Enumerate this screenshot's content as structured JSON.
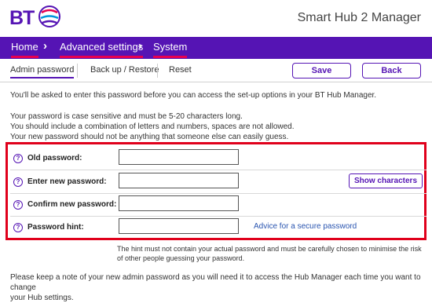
{
  "header": {
    "logo_text": "BT",
    "app_title": "Smart Hub 2 Manager"
  },
  "nav": {
    "items": [
      "Home",
      "Advanced settings",
      "System"
    ]
  },
  "tabs": {
    "items": [
      "Admin password",
      "Back up / Restore",
      "Reset"
    ],
    "active": "Admin password"
  },
  "actions": {
    "save_label": "Save",
    "back_label": "Back"
  },
  "intro": {
    "line1": "You'll be asked to enter this password before you can access the set-up options in your BT Hub Manager.",
    "rules": [
      "Your password is case sensitive and must be 5-20 characters long.",
      "You should include a combination of letters and numbers, spaces are not allowed.",
      "Your new password should not be anything that someone else can easily guess."
    ]
  },
  "form": {
    "old_password_label": "Old password:",
    "old_password_value": "",
    "new_password_label": "Enter new password:",
    "new_password_value": "",
    "confirm_password_label": "Confirm new password:",
    "confirm_password_value": "",
    "hint_label": "Password hint:",
    "hint_value": "",
    "show_characters_label": "Show characters",
    "advice_link_label": "Advice for a secure password",
    "help_glyph": "?"
  },
  "hint_note": {
    "line1": "The hint must not contain your actual password and must be carefully chosen to minimise the risk",
    "line2": "of other people guessing your password."
  },
  "footer_note": {
    "line1": "Please keep a note of your new admin password as you will need it to access the Hub Manager each time you want to change",
    "line2": "your Hub settings."
  },
  "colors": {
    "brand_purple": "#5514b4",
    "nav_underline": "#e60050",
    "highlight_border": "#e0001b",
    "link_blue": "#2a55b0"
  }
}
